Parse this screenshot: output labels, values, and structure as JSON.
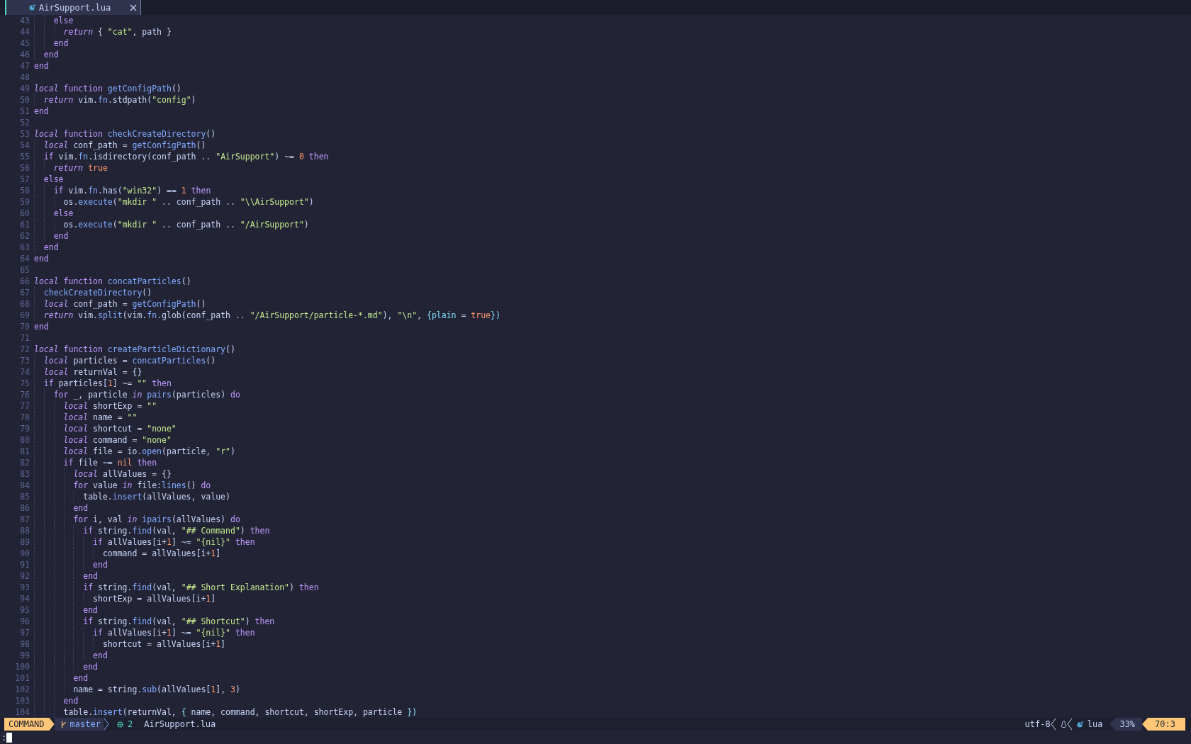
{
  "tab": {
    "title": "AirSupport.lua",
    "selected": true
  },
  "lines": [
    {
      "number": "43",
      "tokens": [
        {
          "kind": "g"
        },
        {
          "kind": "g"
        },
        {
          "kind": "kw",
          "text": "else"
        }
      ]
    },
    {
      "number": "44",
      "tokens": [
        {
          "kind": "g"
        },
        {
          "kind": "g"
        },
        {
          "kind": "g"
        },
        {
          "kind": "it",
          "text": "return"
        },
        {
          "kind": "txt",
          "text": " { "
        },
        {
          "kind": "str",
          "text": "\"cat\""
        },
        {
          "kind": "txt",
          "text": ", path }"
        }
      ]
    },
    {
      "number": "45",
      "tokens": [
        {
          "kind": "g"
        },
        {
          "kind": "g"
        },
        {
          "kind": "kw",
          "text": "end"
        }
      ]
    },
    {
      "number": "46",
      "tokens": [
        {
          "kind": "g"
        },
        {
          "kind": "kw",
          "text": "end"
        }
      ]
    },
    {
      "number": "47",
      "tokens": [
        {
          "kind": "kw",
          "text": "end"
        }
      ]
    },
    {
      "number": "48"
    },
    {
      "number": "49",
      "tokens": [
        {
          "kind": "it",
          "text": "local"
        },
        {
          "kind": "kw",
          "text": " function"
        },
        {
          "kind": "fn",
          "text": " getConfigPath"
        },
        {
          "kind": "txt",
          "text": "()"
        }
      ]
    },
    {
      "number": "50",
      "tokens": [
        {
          "kind": "g"
        },
        {
          "kind": "it",
          "text": "return"
        },
        {
          "kind": "txt",
          "text": " vim."
        },
        {
          "kind": "fn",
          "text": "fn"
        },
        {
          "kind": "txt",
          "text": ".stdpath("
        },
        {
          "kind": "str",
          "text": "\"config\""
        },
        {
          "kind": "txt",
          "text": ")"
        }
      ]
    },
    {
      "number": "51",
      "tokens": [
        {
          "kind": "kw",
          "text": "end"
        }
      ]
    },
    {
      "number": "52"
    },
    {
      "number": "53",
      "tokens": [
        {
          "kind": "it",
          "text": "local"
        },
        {
          "kind": "kw",
          "text": " function"
        },
        {
          "kind": "fn",
          "text": " checkCreateDirectory"
        },
        {
          "kind": "txt",
          "text": "()"
        }
      ]
    },
    {
      "number": "54",
      "tokens": [
        {
          "kind": "g"
        },
        {
          "kind": "it",
          "text": "local"
        },
        {
          "kind": "txt",
          "text": " conf_path = "
        },
        {
          "kind": "fn",
          "text": "getConfigPath"
        },
        {
          "kind": "txt",
          "text": "()"
        }
      ]
    },
    {
      "number": "55",
      "tokens": [
        {
          "kind": "g"
        },
        {
          "kind": "kw",
          "text": "if"
        },
        {
          "kind": "txt",
          "text": " vim."
        },
        {
          "kind": "fn",
          "text": "fn"
        },
        {
          "kind": "txt",
          "text": ".isdirectory(conf_path .. "
        },
        {
          "kind": "str",
          "text": "\"AirSupport\""
        },
        {
          "kind": "txt",
          "text": ") ~= "
        },
        {
          "kind": "num",
          "text": "0"
        },
        {
          "kind": "kw",
          "text": " then"
        }
      ]
    },
    {
      "number": "56",
      "tokens": [
        {
          "kind": "g"
        },
        {
          "kind": "g"
        },
        {
          "kind": "it",
          "text": "return"
        },
        {
          "kind": "num",
          "text": " true"
        }
      ]
    },
    {
      "number": "57",
      "tokens": [
        {
          "kind": "g"
        },
        {
          "kind": "kw",
          "text": "else"
        }
      ]
    },
    {
      "number": "58",
      "tokens": [
        {
          "kind": "g"
        },
        {
          "kind": "g"
        },
        {
          "kind": "kw",
          "text": "if"
        },
        {
          "kind": "txt",
          "text": " vim."
        },
        {
          "kind": "fn",
          "text": "fn"
        },
        {
          "kind": "txt",
          "text": ".has("
        },
        {
          "kind": "str",
          "text": "\"win32\""
        },
        {
          "kind": "txt",
          "text": ") == "
        },
        {
          "kind": "num",
          "text": "1"
        },
        {
          "kind": "kw",
          "text": " then"
        }
      ]
    },
    {
      "number": "59",
      "tokens": [
        {
          "kind": "g"
        },
        {
          "kind": "g"
        },
        {
          "kind": "g"
        },
        {
          "kind": "txt",
          "text": "os."
        },
        {
          "kind": "fn",
          "text": "execute"
        },
        {
          "kind": "txt",
          "text": "("
        },
        {
          "kind": "str",
          "text": "\"mkdir \""
        },
        {
          "kind": "txt",
          "text": " .. conf_path .. "
        },
        {
          "kind": "str",
          "text": "\"\\\\AirSupport\""
        },
        {
          "kind": "txt",
          "text": ")"
        }
      ]
    },
    {
      "number": "60",
      "tokens": [
        {
          "kind": "g"
        },
        {
          "kind": "g"
        },
        {
          "kind": "kw",
          "text": "else"
        }
      ]
    },
    {
      "number": "61",
      "tokens": [
        {
          "kind": "g"
        },
        {
          "kind": "g"
        },
        {
          "kind": "g"
        },
        {
          "kind": "txt",
          "text": "os."
        },
        {
          "kind": "fn",
          "text": "execute"
        },
        {
          "kind": "txt",
          "text": "("
        },
        {
          "kind": "str",
          "text": "\"mkdir \""
        },
        {
          "kind": "txt",
          "text": " .. conf_path .. "
        },
        {
          "kind": "str",
          "text": "\"/AirSupport\""
        },
        {
          "kind": "txt",
          "text": ")"
        }
      ]
    },
    {
      "number": "62",
      "tokens": [
        {
          "kind": "g"
        },
        {
          "kind": "g"
        },
        {
          "kind": "kw",
          "text": "end"
        }
      ]
    },
    {
      "number": "63",
      "tokens": [
        {
          "kind": "g"
        },
        {
          "kind": "kw",
          "text": "end"
        }
      ]
    },
    {
      "number": "64",
      "tokens": [
        {
          "kind": "kw",
          "text": "end"
        }
      ]
    },
    {
      "number": "65"
    },
    {
      "number": "66",
      "tokens": [
        {
          "kind": "it",
          "text": "local"
        },
        {
          "kind": "kw",
          "text": " function"
        },
        {
          "kind": "fn",
          "text": " concatParticles"
        },
        {
          "kind": "txt",
          "text": "()"
        }
      ]
    },
    {
      "number": "67",
      "tokens": [
        {
          "kind": "g"
        },
        {
          "kind": "fn",
          "text": "checkCreateDirectory"
        },
        {
          "kind": "txt",
          "text": "()"
        }
      ]
    },
    {
      "number": "68",
      "tokens": [
        {
          "kind": "g"
        },
        {
          "kind": "it",
          "text": "local"
        },
        {
          "kind": "txt",
          "text": " conf_path = "
        },
        {
          "kind": "fn",
          "text": "getConfigPath"
        },
        {
          "kind": "txt",
          "text": "()"
        }
      ]
    },
    {
      "number": "69",
      "tokens": [
        {
          "kind": "g"
        },
        {
          "kind": "it",
          "text": "return"
        },
        {
          "kind": "txt",
          "text": " vim."
        },
        {
          "kind": "fn",
          "text": "split"
        },
        {
          "kind": "txt",
          "text": "(vim."
        },
        {
          "kind": "fn",
          "text": "fn"
        },
        {
          "kind": "txt",
          "text": ".glob(conf_path .. "
        },
        {
          "kind": "str",
          "text": "\"/AirSupport/particle-*.md\""
        },
        {
          "kind": "txt",
          "text": "), "
        },
        {
          "kind": "str",
          "text": "\"\\n\""
        },
        {
          "kind": "txt",
          "text": ", "
        },
        {
          "kind": "op",
          "text": "{plain"
        },
        {
          "kind": "txt",
          "text": " = "
        },
        {
          "kind": "num",
          "text": "true"
        },
        {
          "kind": "op",
          "text": "})"
        }
      ]
    },
    {
      "number": "70",
      "tokens": [
        {
          "kind": "kw",
          "text": "end"
        }
      ]
    },
    {
      "number": "71"
    },
    {
      "number": "72",
      "tokens": [
        {
          "kind": "it",
          "text": "local"
        },
        {
          "kind": "kw",
          "text": " function"
        },
        {
          "kind": "fn",
          "text": " createParticleDictionary"
        },
        {
          "kind": "txt",
          "text": "()"
        }
      ]
    },
    {
      "number": "73",
      "tokens": [
        {
          "kind": "g"
        },
        {
          "kind": "it",
          "text": "local"
        },
        {
          "kind": "txt",
          "text": " particles = "
        },
        {
          "kind": "fn",
          "text": "concatParticles"
        },
        {
          "kind": "txt",
          "text": "()"
        }
      ]
    },
    {
      "number": "74",
      "tokens": [
        {
          "kind": "g"
        },
        {
          "kind": "it",
          "text": "local"
        },
        {
          "kind": "txt",
          "text": " returnVal = {}"
        }
      ]
    },
    {
      "number": "75",
      "tokens": [
        {
          "kind": "g"
        },
        {
          "kind": "kw",
          "text": "if"
        },
        {
          "kind": "txt",
          "text": " particles["
        },
        {
          "kind": "num",
          "text": "1"
        },
        {
          "kind": "txt",
          "text": "] ~= "
        },
        {
          "kind": "str",
          "text": "\"\""
        },
        {
          "kind": "kw",
          "text": " then"
        }
      ]
    },
    {
      "number": "76",
      "tokens": [
        {
          "kind": "g"
        },
        {
          "kind": "g"
        },
        {
          "kind": "kw",
          "text": "for"
        },
        {
          "kind": "txt",
          "text": " _, particle "
        },
        {
          "kind": "it",
          "text": "in"
        },
        {
          "kind": "fn",
          "text": " pairs"
        },
        {
          "kind": "txt",
          "text": "(particles) "
        },
        {
          "kind": "kw",
          "text": "do"
        }
      ]
    },
    {
      "number": "77",
      "tokens": [
        {
          "kind": "g"
        },
        {
          "kind": "g"
        },
        {
          "kind": "g"
        },
        {
          "kind": "it",
          "text": "local"
        },
        {
          "kind": "txt",
          "text": " shortExp = "
        },
        {
          "kind": "str",
          "text": "\"\""
        }
      ]
    },
    {
      "number": "78",
      "tokens": [
        {
          "kind": "g"
        },
        {
          "kind": "g"
        },
        {
          "kind": "g"
        },
        {
          "kind": "it",
          "text": "local"
        },
        {
          "kind": "txt",
          "text": " name = "
        },
        {
          "kind": "str",
          "text": "\"\""
        }
      ]
    },
    {
      "number": "79",
      "tokens": [
        {
          "kind": "g"
        },
        {
          "kind": "g"
        },
        {
          "kind": "g"
        },
        {
          "kind": "it",
          "text": "local"
        },
        {
          "kind": "txt",
          "text": " shortcut = "
        },
        {
          "kind": "str",
          "text": "\"none\""
        }
      ]
    },
    {
      "number": "80",
      "tokens": [
        {
          "kind": "g"
        },
        {
          "kind": "g"
        },
        {
          "kind": "g"
        },
        {
          "kind": "it",
          "text": "local"
        },
        {
          "kind": "txt",
          "text": " command = "
        },
        {
          "kind": "str",
          "text": "\"none\""
        }
      ]
    },
    {
      "number": "81",
      "tokens": [
        {
          "kind": "g"
        },
        {
          "kind": "g"
        },
        {
          "kind": "g"
        },
        {
          "kind": "it",
          "text": "local"
        },
        {
          "kind": "txt",
          "text": " file = io."
        },
        {
          "kind": "fn",
          "text": "open"
        },
        {
          "kind": "txt",
          "text": "(particle, "
        },
        {
          "kind": "str",
          "text": "\"r\""
        },
        {
          "kind": "txt",
          "text": ")"
        }
      ]
    },
    {
      "number": "82",
      "tokens": [
        {
          "kind": "g"
        },
        {
          "kind": "g"
        },
        {
          "kind": "g"
        },
        {
          "kind": "kw",
          "text": "if"
        },
        {
          "kind": "txt",
          "text": " file ~= "
        },
        {
          "kind": "num",
          "text": "nil"
        },
        {
          "kind": "kw",
          "text": " then"
        }
      ]
    },
    {
      "number": "83",
      "tokens": [
        {
          "kind": "g"
        },
        {
          "kind": "g"
        },
        {
          "kind": "g"
        },
        {
          "kind": "g"
        },
        {
          "kind": "it",
          "text": "local"
        },
        {
          "kind": "txt",
          "text": " allValues = {}"
        }
      ]
    },
    {
      "number": "84",
      "tokens": [
        {
          "kind": "g"
        },
        {
          "kind": "g"
        },
        {
          "kind": "g"
        },
        {
          "kind": "g"
        },
        {
          "kind": "kw",
          "text": "for"
        },
        {
          "kind": "txt",
          "text": " value "
        },
        {
          "kind": "it",
          "text": "in"
        },
        {
          "kind": "txt",
          "text": " file:"
        },
        {
          "kind": "fn",
          "text": "lines"
        },
        {
          "kind": "txt",
          "text": "() "
        },
        {
          "kind": "kw",
          "text": "do"
        }
      ]
    },
    {
      "number": "85",
      "tokens": [
        {
          "kind": "g"
        },
        {
          "kind": "g"
        },
        {
          "kind": "g"
        },
        {
          "kind": "g"
        },
        {
          "kind": "g"
        },
        {
          "kind": "txt",
          "text": "table."
        },
        {
          "kind": "fn",
          "text": "insert"
        },
        {
          "kind": "txt",
          "text": "(allValues, value)"
        }
      ]
    },
    {
      "number": "86",
      "tokens": [
        {
          "kind": "g"
        },
        {
          "kind": "g"
        },
        {
          "kind": "g"
        },
        {
          "kind": "g"
        },
        {
          "kind": "kw",
          "text": "end"
        }
      ]
    },
    {
      "number": "87",
      "tokens": [
        {
          "kind": "g"
        },
        {
          "kind": "g"
        },
        {
          "kind": "g"
        },
        {
          "kind": "g"
        },
        {
          "kind": "kw",
          "text": "for"
        },
        {
          "kind": "txt",
          "text": " i, val "
        },
        {
          "kind": "it",
          "text": "in"
        },
        {
          "kind": "fn",
          "text": " ipairs"
        },
        {
          "kind": "txt",
          "text": "(allValues) "
        },
        {
          "kind": "kw",
          "text": "do"
        }
      ]
    },
    {
      "number": "88",
      "tokens": [
        {
          "kind": "g"
        },
        {
          "kind": "g"
        },
        {
          "kind": "g"
        },
        {
          "kind": "g"
        },
        {
          "kind": "g"
        },
        {
          "kind": "kw",
          "text": "if"
        },
        {
          "kind": "txt",
          "text": " string."
        },
        {
          "kind": "fn",
          "text": "find"
        },
        {
          "kind": "txt",
          "text": "(val, "
        },
        {
          "kind": "str",
          "text": "\"## Command\""
        },
        {
          "kind": "txt",
          "text": ") "
        },
        {
          "kind": "kw",
          "text": "then"
        }
      ]
    },
    {
      "number": "89",
      "tokens": [
        {
          "kind": "g"
        },
        {
          "kind": "g"
        },
        {
          "kind": "g"
        },
        {
          "kind": "g"
        },
        {
          "kind": "g"
        },
        {
          "kind": "g"
        },
        {
          "kind": "kw",
          "text": "if"
        },
        {
          "kind": "txt",
          "text": " allValues[i+"
        },
        {
          "kind": "num",
          "text": "1"
        },
        {
          "kind": "txt",
          "text": "] ~= "
        },
        {
          "kind": "str",
          "text": "\"{nil}\""
        },
        {
          "kind": "kw",
          "text": " then"
        }
      ]
    },
    {
      "number": "90",
      "tokens": [
        {
          "kind": "g"
        },
        {
          "kind": "g"
        },
        {
          "kind": "g"
        },
        {
          "kind": "g"
        },
        {
          "kind": "g"
        },
        {
          "kind": "g"
        },
        {
          "kind": "g"
        },
        {
          "kind": "txt",
          "text": "command = allValues[i+"
        },
        {
          "kind": "num",
          "text": "1"
        },
        {
          "kind": "txt",
          "text": "]"
        }
      ]
    },
    {
      "number": "91",
      "tokens": [
        {
          "kind": "g"
        },
        {
          "kind": "g"
        },
        {
          "kind": "g"
        },
        {
          "kind": "g"
        },
        {
          "kind": "g"
        },
        {
          "kind": "g"
        },
        {
          "kind": "kw",
          "text": "end"
        }
      ]
    },
    {
      "number": "92",
      "tokens": [
        {
          "kind": "g"
        },
        {
          "kind": "g"
        },
        {
          "kind": "g"
        },
        {
          "kind": "g"
        },
        {
          "kind": "g"
        },
        {
          "kind": "kw",
          "text": "end"
        }
      ]
    },
    {
      "number": "93",
      "tokens": [
        {
          "kind": "g"
        },
        {
          "kind": "g"
        },
        {
          "kind": "g"
        },
        {
          "kind": "g"
        },
        {
          "kind": "g"
        },
        {
          "kind": "kw",
          "text": "if"
        },
        {
          "kind": "txt",
          "text": " string."
        },
        {
          "kind": "fn",
          "text": "find"
        },
        {
          "kind": "txt",
          "text": "(val, "
        },
        {
          "kind": "str",
          "text": "\"## Short Explanation\""
        },
        {
          "kind": "txt",
          "text": ") "
        },
        {
          "kind": "kw",
          "text": "then"
        }
      ]
    },
    {
      "number": "94",
      "tokens": [
        {
          "kind": "g"
        },
        {
          "kind": "g"
        },
        {
          "kind": "g"
        },
        {
          "kind": "g"
        },
        {
          "kind": "g"
        },
        {
          "kind": "g"
        },
        {
          "kind": "txt",
          "text": "shortExp = allValues[i+"
        },
        {
          "kind": "num",
          "text": "1"
        },
        {
          "kind": "txt",
          "text": "]"
        }
      ]
    },
    {
      "number": "95",
      "tokens": [
        {
          "kind": "g"
        },
        {
          "kind": "g"
        },
        {
          "kind": "g"
        },
        {
          "kind": "g"
        },
        {
          "kind": "g"
        },
        {
          "kind": "kw",
          "text": "end"
        }
      ]
    },
    {
      "number": "96",
      "tokens": [
        {
          "kind": "g"
        },
        {
          "kind": "g"
        },
        {
          "kind": "g"
        },
        {
          "kind": "g"
        },
        {
          "kind": "g"
        },
        {
          "kind": "kw",
          "text": "if"
        },
        {
          "kind": "txt",
          "text": " string."
        },
        {
          "kind": "fn",
          "text": "find"
        },
        {
          "kind": "txt",
          "text": "(val, "
        },
        {
          "kind": "str",
          "text": "\"## Shortcut\""
        },
        {
          "kind": "txt",
          "text": ") "
        },
        {
          "kind": "kw",
          "text": "then"
        }
      ]
    },
    {
      "number": "97",
      "tokens": [
        {
          "kind": "g"
        },
        {
          "kind": "g"
        },
        {
          "kind": "g"
        },
        {
          "kind": "g"
        },
        {
          "kind": "g"
        },
        {
          "kind": "g"
        },
        {
          "kind": "kw",
          "text": "if"
        },
        {
          "kind": "txt",
          "text": " allValues[i+"
        },
        {
          "kind": "num",
          "text": "1"
        },
        {
          "kind": "txt",
          "text": "] ~= "
        },
        {
          "kind": "str",
          "text": "\"{nil}\""
        },
        {
          "kind": "kw",
          "text": " then"
        }
      ]
    },
    {
      "number": "98",
      "tokens": [
        {
          "kind": "g"
        },
        {
          "kind": "g"
        },
        {
          "kind": "g"
        },
        {
          "kind": "g"
        },
        {
          "kind": "g"
        },
        {
          "kind": "g"
        },
        {
          "kind": "g"
        },
        {
          "kind": "txt",
          "text": "shortcut = allValues[i+"
        },
        {
          "kind": "num",
          "text": "1"
        },
        {
          "kind": "txt",
          "text": "]"
        }
      ]
    },
    {
      "number": "99",
      "tokens": [
        {
          "kind": "g"
        },
        {
          "kind": "g"
        },
        {
          "kind": "g"
        },
        {
          "kind": "g"
        },
        {
          "kind": "g"
        },
        {
          "kind": "g"
        },
        {
          "kind": "kw",
          "text": "end"
        }
      ]
    },
    {
      "number": "100",
      "tokens": [
        {
          "kind": "g"
        },
        {
          "kind": "g"
        },
        {
          "kind": "g"
        },
        {
          "kind": "g"
        },
        {
          "kind": "g"
        },
        {
          "kind": "kw",
          "text": "end"
        }
      ]
    },
    {
      "number": "101",
      "tokens": [
        {
          "kind": "g"
        },
        {
          "kind": "g"
        },
        {
          "kind": "g"
        },
        {
          "kind": "g"
        },
        {
          "kind": "kw",
          "text": "end"
        }
      ]
    },
    {
      "number": "102",
      "tokens": [
        {
          "kind": "g"
        },
        {
          "kind": "g"
        },
        {
          "kind": "g"
        },
        {
          "kind": "g"
        },
        {
          "kind": "txt",
          "text": "name = string."
        },
        {
          "kind": "fn",
          "text": "sub"
        },
        {
          "kind": "txt",
          "text": "(allValues["
        },
        {
          "kind": "num",
          "text": "1"
        },
        {
          "kind": "txt",
          "text": "], "
        },
        {
          "kind": "num",
          "text": "3"
        },
        {
          "kind": "txt",
          "text": ")"
        }
      ]
    },
    {
      "number": "103",
      "tokens": [
        {
          "kind": "g"
        },
        {
          "kind": "g"
        },
        {
          "kind": "g"
        },
        {
          "kind": "kw",
          "text": "end"
        }
      ]
    },
    {
      "number": "104",
      "tokens": [
        {
          "kind": "g"
        },
        {
          "kind": "g"
        },
        {
          "kind": "g"
        },
        {
          "kind": "txt",
          "text": "table."
        },
        {
          "kind": "fn",
          "text": "insert"
        },
        {
          "kind": "txt",
          "text": "(returnVal, "
        },
        {
          "kind": "op",
          "text": "{"
        },
        {
          "kind": "txt",
          "text": " name, command, shortcut, shortExp, particle "
        },
        {
          "kind": "op",
          "text": "})"
        }
      ]
    }
  ],
  "status_bar": {
    "mode": "COMMAND",
    "branch": "master",
    "changes": "2",
    "file": "AirSupport.lua",
    "encoding": "utf-8",
    "filetype": "lua",
    "percent": "33%",
    "position": "70:3"
  },
  "command_line": {
    "text": ":"
  }
}
